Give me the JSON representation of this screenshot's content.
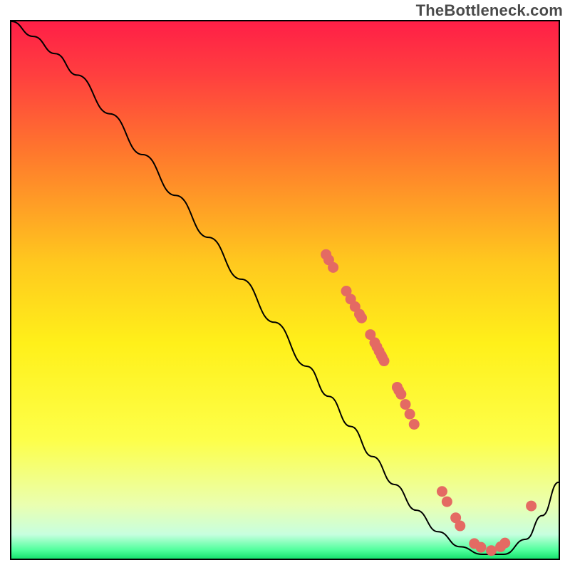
{
  "watermark": "TheBottleneck.com",
  "chart_data": {
    "type": "line",
    "title": "",
    "xlabel": "",
    "ylabel": "",
    "xlim": [
      0,
      1
    ],
    "ylim": [
      0,
      1
    ],
    "gradient_stops": [
      {
        "offset": 0.0,
        "color": "#ff1f47"
      },
      {
        "offset": 0.1,
        "color": "#ff3f3f"
      },
      {
        "offset": 0.25,
        "color": "#ff7a2c"
      },
      {
        "offset": 0.45,
        "color": "#ffc91e"
      },
      {
        "offset": 0.6,
        "color": "#fff01a"
      },
      {
        "offset": 0.78,
        "color": "#fdff4a"
      },
      {
        "offset": 0.9,
        "color": "#eaffb0"
      },
      {
        "offset": 0.955,
        "color": "#c7ffdf"
      },
      {
        "offset": 0.985,
        "color": "#4cff9a"
      },
      {
        "offset": 1.0,
        "color": "#18e26e"
      }
    ],
    "series": [
      {
        "name": "curve",
        "x": [
          0.0,
          0.04,
          0.08,
          0.12,
          0.18,
          0.24,
          0.3,
          0.36,
          0.42,
          0.48,
          0.54,
          0.58,
          0.62,
          0.66,
          0.7,
          0.74,
          0.78,
          0.82,
          0.86,
          0.9,
          0.94,
          0.97,
          1.0
        ],
        "y": [
          1.0,
          0.972,
          0.94,
          0.9,
          0.828,
          0.752,
          0.676,
          0.598,
          0.52,
          0.44,
          0.358,
          0.302,
          0.246,
          0.19,
          0.138,
          0.09,
          0.05,
          0.022,
          0.008,
          0.008,
          0.036,
          0.08,
          0.142
        ]
      }
    ],
    "markers": [
      {
        "x": 0.575,
        "y": 0.566
      },
      {
        "x": 0.58,
        "y": 0.556
      },
      {
        "x": 0.588,
        "y": 0.542
      },
      {
        "x": 0.612,
        "y": 0.498
      },
      {
        "x": 0.62,
        "y": 0.483
      },
      {
        "x": 0.628,
        "y": 0.469
      },
      {
        "x": 0.636,
        "y": 0.455
      },
      {
        "x": 0.64,
        "y": 0.448
      },
      {
        "x": 0.656,
        "y": 0.417
      },
      {
        "x": 0.664,
        "y": 0.402
      },
      {
        "x": 0.668,
        "y": 0.394
      },
      {
        "x": 0.672,
        "y": 0.386
      },
      {
        "x": 0.676,
        "y": 0.378
      },
      {
        "x": 0.678,
        "y": 0.374
      },
      {
        "x": 0.681,
        "y": 0.368
      },
      {
        "x": 0.705,
        "y": 0.319
      },
      {
        "x": 0.708,
        "y": 0.313
      },
      {
        "x": 0.712,
        "y": 0.306
      },
      {
        "x": 0.72,
        "y": 0.287
      },
      {
        "x": 0.728,
        "y": 0.269
      },
      {
        "x": 0.736,
        "y": 0.25
      },
      {
        "x": 0.787,
        "y": 0.125
      },
      {
        "x": 0.796,
        "y": 0.106
      },
      {
        "x": 0.812,
        "y": 0.076
      },
      {
        "x": 0.82,
        "y": 0.061
      },
      {
        "x": 0.846,
        "y": 0.028
      },
      {
        "x": 0.858,
        "y": 0.021
      },
      {
        "x": 0.877,
        "y": 0.015
      },
      {
        "x": 0.894,
        "y": 0.022
      },
      {
        "x": 0.902,
        "y": 0.029
      },
      {
        "x": 0.95,
        "y": 0.098
      }
    ],
    "marker_style": {
      "color": "#e46a63",
      "r": 7.5
    },
    "curve_style": {
      "color": "#000000",
      "width": 2
    }
  }
}
